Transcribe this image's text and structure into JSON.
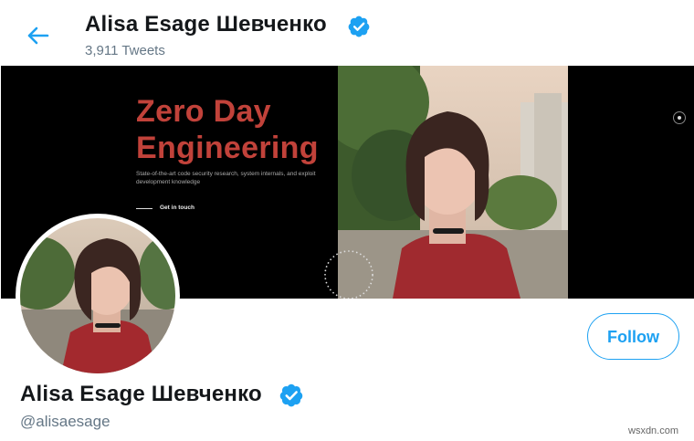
{
  "header": {
    "name": "Alisa Esage Шевченко",
    "tweet_count": "3,911 Tweets",
    "back_icon": "arrow-left-icon"
  },
  "banner": {
    "title_line1": "Zero Day",
    "title_line2": "Engineering",
    "tagline": "State-of-the-art code security research, system internals, and exploit development knowledge",
    "cta": "Get in touch",
    "title_color": "#c1423a"
  },
  "profile": {
    "name": "Alisa Esage Шевченко",
    "handle": "@alisaesage",
    "follow_label": "Follow",
    "verified_icon": "verified-badge-icon"
  },
  "colors": {
    "accent": "#1da1f2",
    "muted": "#657786"
  },
  "watermark": "wsxdn.com"
}
